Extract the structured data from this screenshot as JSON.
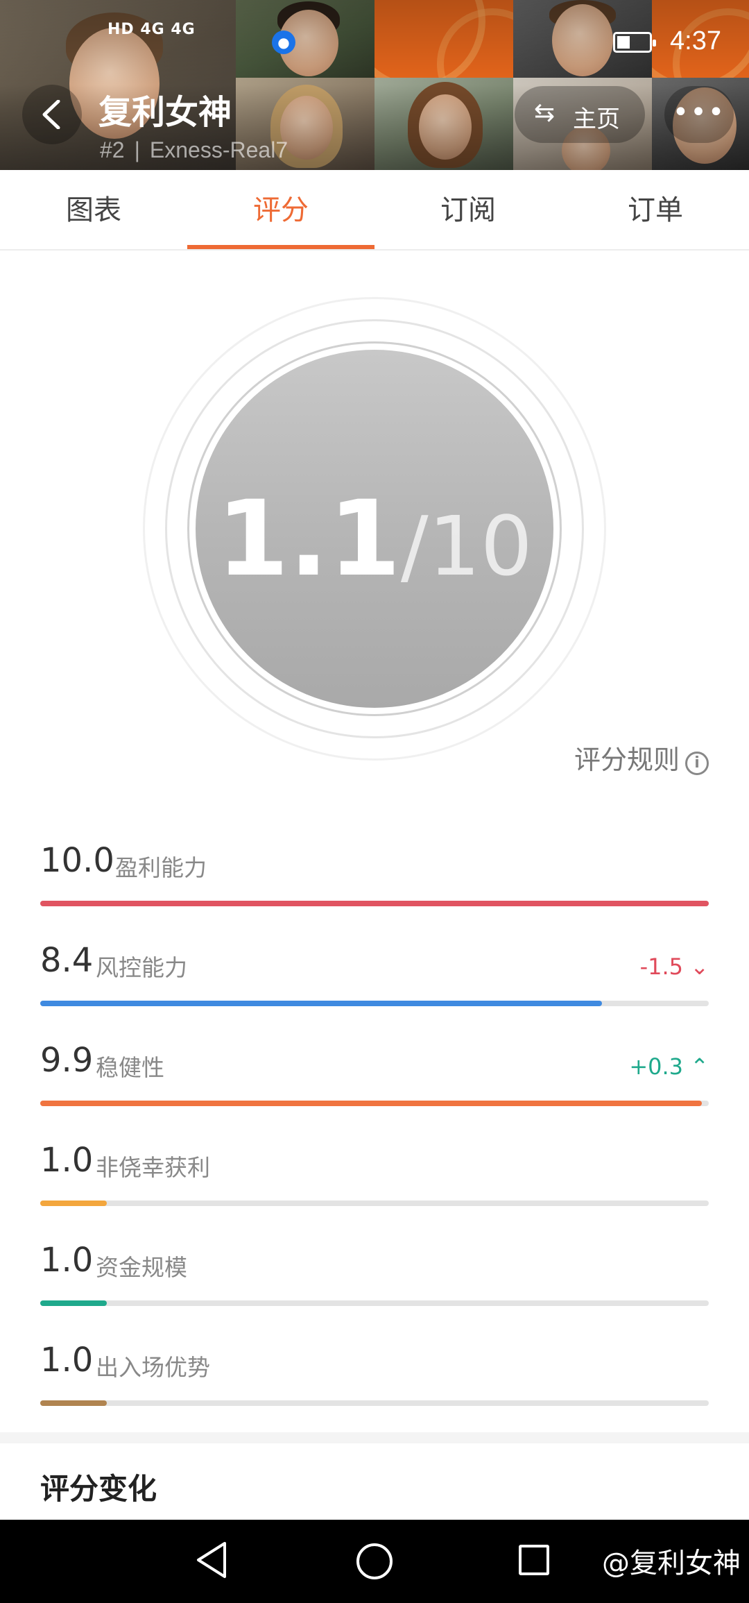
{
  "status_bar": {
    "signal_text": "HD 4G 4G",
    "time": "4:37"
  },
  "header": {
    "title": "复利女神",
    "rank": "#2",
    "account": "Exness-Real7",
    "home_button": "主页"
  },
  "tabs": [
    {
      "label": "图表"
    },
    {
      "label": "评分"
    },
    {
      "label": "订阅"
    },
    {
      "label": "订单"
    }
  ],
  "active_tab": "评分",
  "score": {
    "value": "1.1",
    "max": "/10"
  },
  "rules_link": "评分规则",
  "metrics": [
    {
      "value": "10.0",
      "name": "盈利能力",
      "fraction": 1.0,
      "color": "#e05461",
      "change": ""
    },
    {
      "value": "8.4",
      "name": "风控能力",
      "fraction": 0.84,
      "color": "#3f8ae0",
      "change": "-1.5",
      "trend": "down"
    },
    {
      "value": "9.9",
      "name": "稳健性",
      "fraction": 0.99,
      "color": "#f07440",
      "change": "+0.3",
      "trend": "up"
    },
    {
      "value": "1.0",
      "name": "非侥幸获利",
      "fraction": 0.1,
      "color": "#f3a63d",
      "change": ""
    },
    {
      "value": "1.0",
      "name": "资金规模",
      "fraction": 0.1,
      "color": "#1fa98c",
      "change": ""
    },
    {
      "value": "1.0",
      "name": "出入场优势",
      "fraction": 0.1,
      "color": "#b08450",
      "change": ""
    }
  ],
  "section_title": "评分变化",
  "watermark": "@复利女神",
  "colors": {
    "accent": "#ee6a34",
    "header_orange": "#f26b1d"
  }
}
